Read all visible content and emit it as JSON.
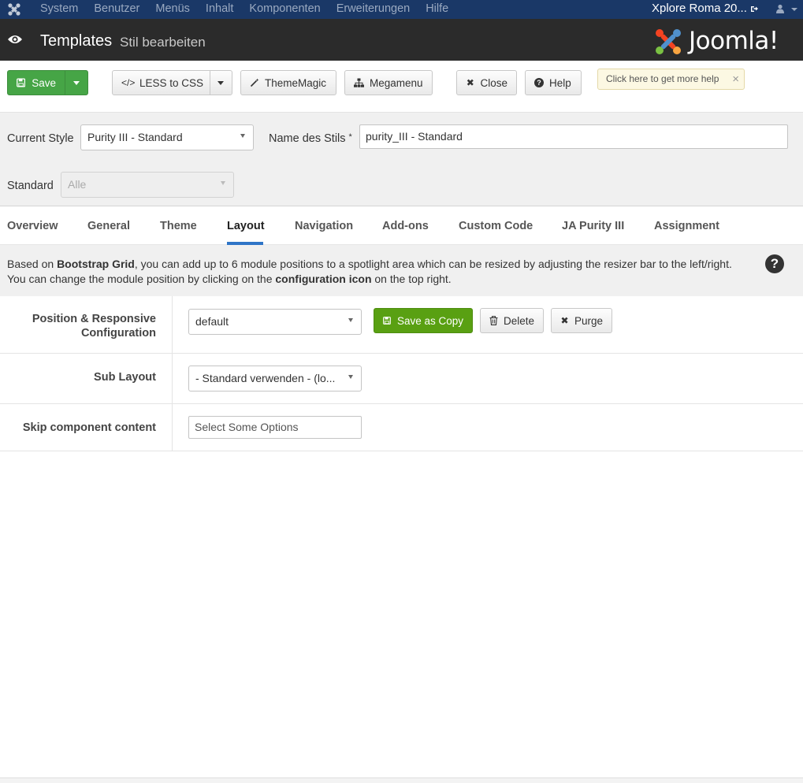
{
  "topnav": {
    "menu": [
      "System",
      "Benutzer",
      "Menüs",
      "Inhalt",
      "Komponenten",
      "Erweiterungen",
      "Hilfe"
    ],
    "site_name": "Xplore Roma 20...",
    "icons": [
      "joomla-icon",
      "external-link-icon",
      "user-icon"
    ]
  },
  "header": {
    "title": "Templates",
    "subtitle": "Stil bearbeiten",
    "logo_text": "Joomla!"
  },
  "toolbar": {
    "save": "Save",
    "less_to_css": "LESS to CSS",
    "theme_magic": "ThemeMagic",
    "megamenu": "Megamenu",
    "close": "Close",
    "help": "Help",
    "tooltip": "Click here to get more help"
  },
  "form": {
    "current_style_label": "Current Style",
    "current_style_value": "Purity III - Standard",
    "name_label": "Name des Stils",
    "name_required": "*",
    "name_value": "purity_III - Standard",
    "standard_label": "Standard",
    "standard_value": "Alle"
  },
  "tabs": [
    "Overview",
    "General",
    "Theme",
    "Layout",
    "Navigation",
    "Add-ons",
    "Custom Code",
    "JA Purity III",
    "Assignment"
  ],
  "active_tab": "Layout",
  "info": {
    "line1_a": "Based on ",
    "line1_b": "Bootstrap Grid",
    "line1_c": ", you can add up to 6 module positions to a spotlight area which can be resized by adjusting the resizer bar to the left/right.",
    "line2_a": "You can change the module position by clicking on the ",
    "line2_b": "configuration icon",
    "line2_c": " on the top right.",
    "help_glyph": "?"
  },
  "config": {
    "position_label_1": "Position & Responsive",
    "position_label_2": "Configuration",
    "position_value": "default",
    "save_as_copy": "Save as Copy",
    "delete": "Delete",
    "purge": "Purge",
    "sublayout_label": "Sub Layout",
    "sublayout_value": "- Standard verwenden - (lo...",
    "skip_label": "Skip component content",
    "skip_placeholder": "Select Some Options"
  }
}
